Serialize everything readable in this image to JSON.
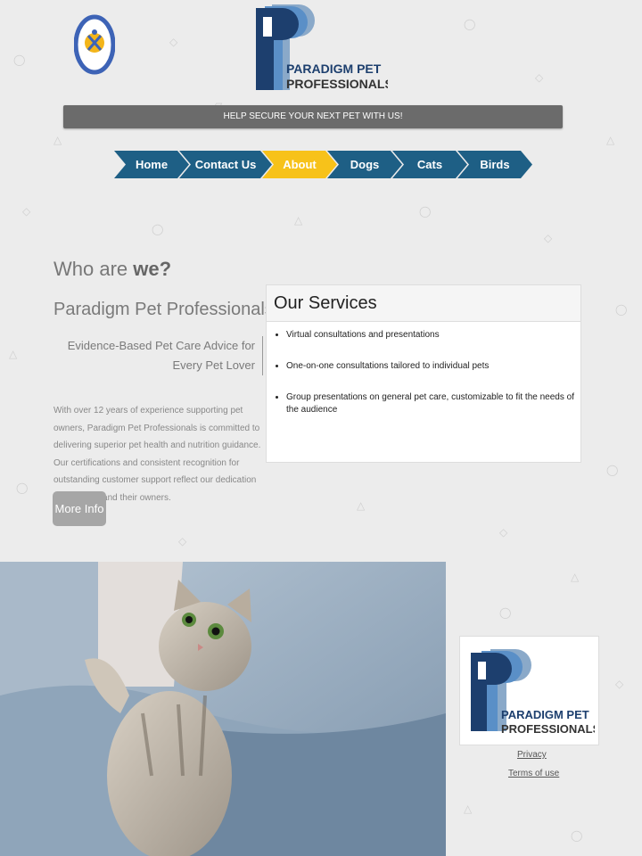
{
  "header": {
    "badge_logo_icon": "paw-dog-badge-icon",
    "logo": {
      "line1": "PARADIGM PET",
      "line2": "PROFESSIONALS"
    },
    "banner_text": "HELP SECURE YOUR NEXT PET WITH US!"
  },
  "nav": {
    "items": [
      {
        "label": "Home"
      },
      {
        "label": "Contact Us"
      },
      {
        "label": "About",
        "active": true
      },
      {
        "label": "Dogs"
      },
      {
        "label": "Cats"
      },
      {
        "label": "Birds"
      }
    ]
  },
  "about": {
    "heading_prefix": "Who are",
    "heading_emphasis": "we?",
    "company": "Paradigm Pet Professionals",
    "quote": "Evidence-Based Pet Care Advice for Every Pet Lover",
    "body": "With over 12 years of experience supporting pet owners, Paradigm Pet Professionals is committed to delivering superior pet health and nutrition guidance. Our certifications and consistent recognition for outstanding customer support reflect our dedication to both pets and their owners.",
    "button": "More Info"
  },
  "services": {
    "title": "Our Services",
    "items": [
      "Virtual consultations and presentations",
      "One-on-one consultations tailored to individual pets",
      "Group presentations on general pet care, customizable to fit the needs of the audience"
    ]
  },
  "footer": {
    "logo": {
      "line1": "PARADIGM PET",
      "line2": "PROFESSIONALS"
    },
    "links": {
      "privacy": "Privacy",
      "terms": "Terms of use"
    }
  },
  "colors": {
    "nav_blue": "#1e5f85",
    "nav_active": "#f7c21a",
    "banner_gray": "#6b6b6b",
    "logo_navy": "#1d3f6e",
    "logo_blue": "#5a8fc7"
  }
}
